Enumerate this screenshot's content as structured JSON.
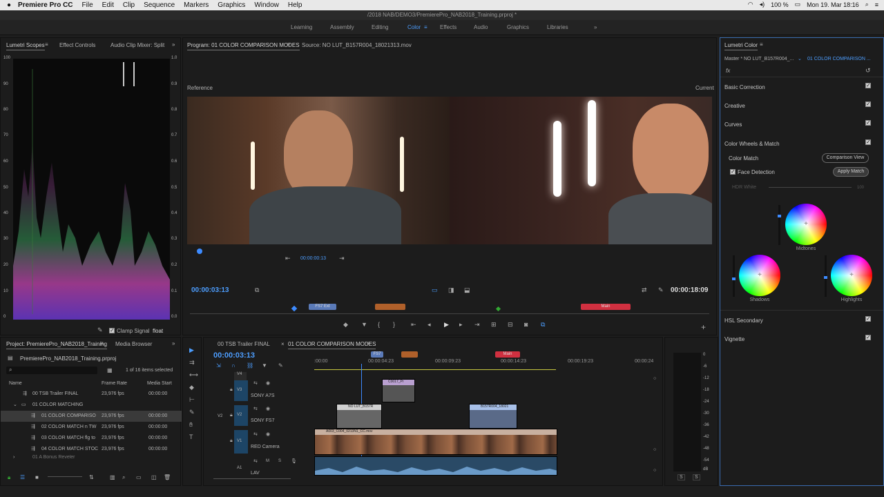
{
  "menubar": {
    "apple": "",
    "app": "Premiere Pro CC",
    "items": [
      "File",
      "Edit",
      "Clip",
      "Sequence",
      "Markers",
      "Graphics",
      "Window",
      "Help"
    ],
    "battery": "100 %",
    "datetime": "Mon 19. Mar 18:16"
  },
  "title": "/2018 NAB/DEMO3/PremierePro_NAB2018_Training.prproj *",
  "workspaces": [
    "Learning",
    "Assembly",
    "Editing",
    "Color",
    "Effects",
    "Audio",
    "Graphics",
    "Libraries"
  ],
  "workspace_active": "Color",
  "more": "»",
  "scopes": {
    "tabs": [
      "Lumetri Scopes",
      "Effect Controls",
      "Audio Clip Mixer: Split"
    ],
    "left_axis": [
      "100",
      "90",
      "80",
      "70",
      "60",
      "50",
      "40",
      "30",
      "20",
      "10",
      "0"
    ],
    "right_axis": [
      "1.0",
      "0.9",
      "0.8",
      "0.7",
      "0.6",
      "0.5",
      "0.4",
      "0.3",
      "0.2",
      "0.1",
      "0.0"
    ],
    "clamp": "Clamp Signal",
    "float": "float"
  },
  "program": {
    "tab": "Program: 01 COLOR COMPARISON MODES",
    "source": "Source: NO LUT_B157R004_18021313.mov",
    "reference": "Reference",
    "current": "Current",
    "ref_tc": "00:00:00:13",
    "tc_left": "00:00:03:13",
    "tc_right": "00:00:18:09",
    "markers": [
      "FS7 Ext",
      "",
      "Main"
    ]
  },
  "lumetri": {
    "title": "Lumetri Color",
    "master": "Master * NO LUT_B157R004_...",
    "seq": "01 COLOR COMPARISON ...",
    "fx": "fx",
    "sections": [
      "Basic Correction",
      "Creative",
      "Curves",
      "Color Wheels & Match"
    ],
    "color_match": "Color Match",
    "comparison_view": "Comparison View",
    "face_detection": "Face Detection",
    "apply_match": "Apply Match",
    "hdr_white": "HDR White",
    "hdr_val": "100",
    "midtones": "Midtones",
    "shadows": "Shadows",
    "highlights": "Highlights",
    "hsl": "HSL Secondary",
    "vignette": "Vignette",
    "accent": "#4d9eff"
  },
  "project": {
    "tab": "Project: PremierePro_NAB2018_Training",
    "media_browser": "Media Browser",
    "file": "PremierePro_NAB2018_Training.prproj",
    "selected": "1 of 16 items selected",
    "cols": [
      "Name",
      "Frame Rate",
      "Media Start"
    ],
    "rows": [
      {
        "name": "00 TSB Trailer FINAL",
        "fps": "23,976 fps",
        "start": "00:00:00"
      },
      {
        "name": "01 COLOR MATCHING",
        "fps": "",
        "start": ""
      },
      {
        "name": "01 COLOR COMPARISO",
        "fps": "23,976 fps",
        "start": "00:00:00"
      },
      {
        "name": "02 COLOR MATCH n TW",
        "fps": "23,976 fps",
        "start": "00:00:00"
      },
      {
        "name": "03 COLOR MATCH flg to",
        "fps": "23,976 fps",
        "start": "00:00:00"
      },
      {
        "name": "04 COLOR MATCH STOC",
        "fps": "23,976 fps",
        "start": "00:00:00"
      },
      {
        "name": "01 A Bonus Reveler",
        "fps": "",
        "start": ""
      }
    ]
  },
  "timeline": {
    "tabs": [
      "00 TSB Trailer FINAL",
      "01 COLOR COMPARISON MODES"
    ],
    "tc": "00:00:03:13",
    "ruler": [
      ":00:00",
      "00:00:04:23",
      "00:00:09:23",
      "00:00:14:23",
      "00:00:19:23",
      "00:00:24"
    ],
    "tracks": [
      {
        "id": "V4",
        "name": ""
      },
      {
        "id": "V3",
        "name": "SONY A7S"
      },
      {
        "id": "V2",
        "name": "SONY FS7"
      },
      {
        "id": "V1",
        "name": "RED Camera"
      },
      {
        "id": "A1",
        "name": "LAV"
      }
    ],
    "clips": [
      "C0017_Pr",
      "NO LUT_B157R",
      "B157R004_18021",
      "A003_C004_0213N1_CC.mov"
    ],
    "mk": [
      "FS7",
      "",
      "Main"
    ]
  },
  "meters": {
    "scale": [
      "0",
      "-6",
      "-12",
      "-18",
      "-24",
      "-30",
      "-36",
      "-42",
      "-48",
      "-54",
      "dB"
    ],
    "s": "S"
  }
}
